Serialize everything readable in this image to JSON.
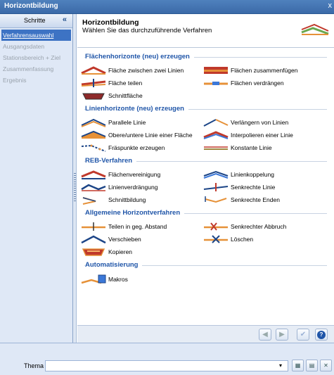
{
  "window": {
    "title": "Horizontbildung",
    "close": "x"
  },
  "sidebar": {
    "header": "Schritte",
    "collapse": "«",
    "steps": [
      {
        "label": "Verfahrensauswahl",
        "active": true
      },
      {
        "label": "Ausgangsdaten",
        "active": false
      },
      {
        "label": "Stationsbereich + Ziel",
        "active": false
      },
      {
        "label": "Zusammenfassung",
        "active": false
      },
      {
        "label": "Ergebnis",
        "active": false
      }
    ]
  },
  "header": {
    "title": "Horizontbildung",
    "subtitle": "Wählen Sie das durchzuführende Verfahren"
  },
  "sections": {
    "flaechen": {
      "title": "Flächenhorizonte (neu) erzeugen",
      "items": [
        "Fläche zwischen zwei Linien",
        "Flächen zusammenfügen",
        "Fläche teilen",
        "Flächen verdrängen",
        "Schnittfläche"
      ]
    },
    "linien": {
      "title": "Linienhorizonte (neu) erzeugen",
      "items": [
        "Parallele Linie",
        "Verlängern von Linien",
        "Obere/untere Linie einer Fläche",
        "Interpolieren einer Linie",
        "Fräspunkte erzeugen",
        "Konstante Linie"
      ]
    },
    "reb": {
      "title": "REB-Verfahren",
      "items": [
        "Flächenvereinigung",
        "Linienkoppelung",
        "Linienverdrängung",
        "Senkrechte Linie",
        "Schnittbildung",
        "Senkrechte Enden"
      ]
    },
    "allgemein": {
      "title": "Allgemeine Horizontverfahren",
      "items": [
        "Teilen in geg. Abstand",
        "Senkrechter Abbruch",
        "Verschieben",
        "Löschen",
        "Kopieren"
      ]
    },
    "auto": {
      "title": "Automatisierung",
      "items": [
        "Makros"
      ]
    }
  },
  "footer": {
    "thema_label": "Thema",
    "thema_value": ""
  },
  "colors": {
    "accent": "#1f55a8",
    "titlebar": "#4f81bd",
    "sidebar": "#dfe8f6"
  }
}
